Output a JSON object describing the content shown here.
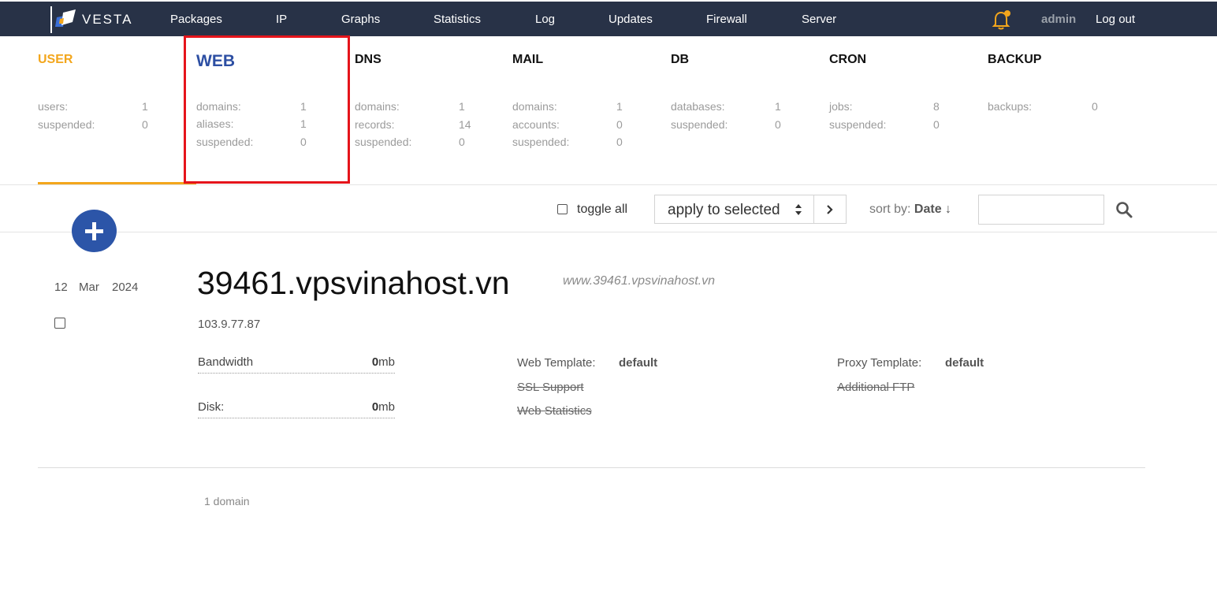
{
  "brand": {
    "name": "VESTA"
  },
  "nav": {
    "items": [
      "Packages",
      "IP",
      "Graphs",
      "Statistics",
      "Log",
      "Updates",
      "Firewall",
      "Server"
    ],
    "user": "admin",
    "logout": "Log out"
  },
  "tabs": [
    {
      "title": "USER",
      "stats": [
        {
          "label": "users:",
          "value": "1"
        },
        {
          "label": "suspended:",
          "value": "0"
        }
      ]
    },
    {
      "title": "WEB",
      "stats": [
        {
          "label": "domains:",
          "value": "1"
        },
        {
          "label": "aliases:",
          "value": "1"
        },
        {
          "label": "suspended:",
          "value": "0"
        }
      ]
    },
    {
      "title": "DNS",
      "stats": [
        {
          "label": "domains:",
          "value": "1"
        },
        {
          "label": "records:",
          "value": "14"
        },
        {
          "label": "suspended:",
          "value": "0"
        }
      ]
    },
    {
      "title": "MAIL",
      "stats": [
        {
          "label": "domains:",
          "value": "1"
        },
        {
          "label": "accounts:",
          "value": "0"
        },
        {
          "label": "suspended:",
          "value": "0"
        }
      ]
    },
    {
      "title": "DB",
      "stats": [
        {
          "label": "databases:",
          "value": "1"
        },
        {
          "label": "suspended:",
          "value": "0"
        }
      ]
    },
    {
      "title": "CRON",
      "stats": [
        {
          "label": "jobs:",
          "value": "8"
        },
        {
          "label": "suspended:",
          "value": "0"
        }
      ]
    },
    {
      "title": "BACKUP",
      "stats": [
        {
          "label": "backups:",
          "value": "0"
        }
      ]
    }
  ],
  "toolbar": {
    "toggle_all": "toggle all",
    "apply_selected": "apply to selected",
    "sort_label": "sort by:",
    "sort_value": "Date ↓",
    "search_value": ""
  },
  "domain": {
    "day": "12",
    "month": "Mar",
    "year": "2024",
    "name": "39461.vpsvinahost.vn",
    "alias": "www.39461.vpsvinahost.vn",
    "ip": "103.9.77.87",
    "bandwidth_label": "Bandwidth",
    "bandwidth_value": "0",
    "disk_label": "Disk:",
    "disk_value": "0",
    "unit": "mb",
    "web_template_label": "Web Template:",
    "web_template_value": "default",
    "ssl_support": "SSL Support",
    "web_statistics": "Web Statistics",
    "proxy_template_label": "Proxy Template:",
    "proxy_template_value": "default",
    "additional_ftp": "Additional FTP"
  },
  "footer": {
    "count": "1 domain"
  },
  "colors": {
    "navbar": "#283247",
    "user_accent": "#f3a61c",
    "web_accent": "#2d4fa3",
    "highlight": "#e5141b",
    "add_button": "#2c55a8"
  }
}
